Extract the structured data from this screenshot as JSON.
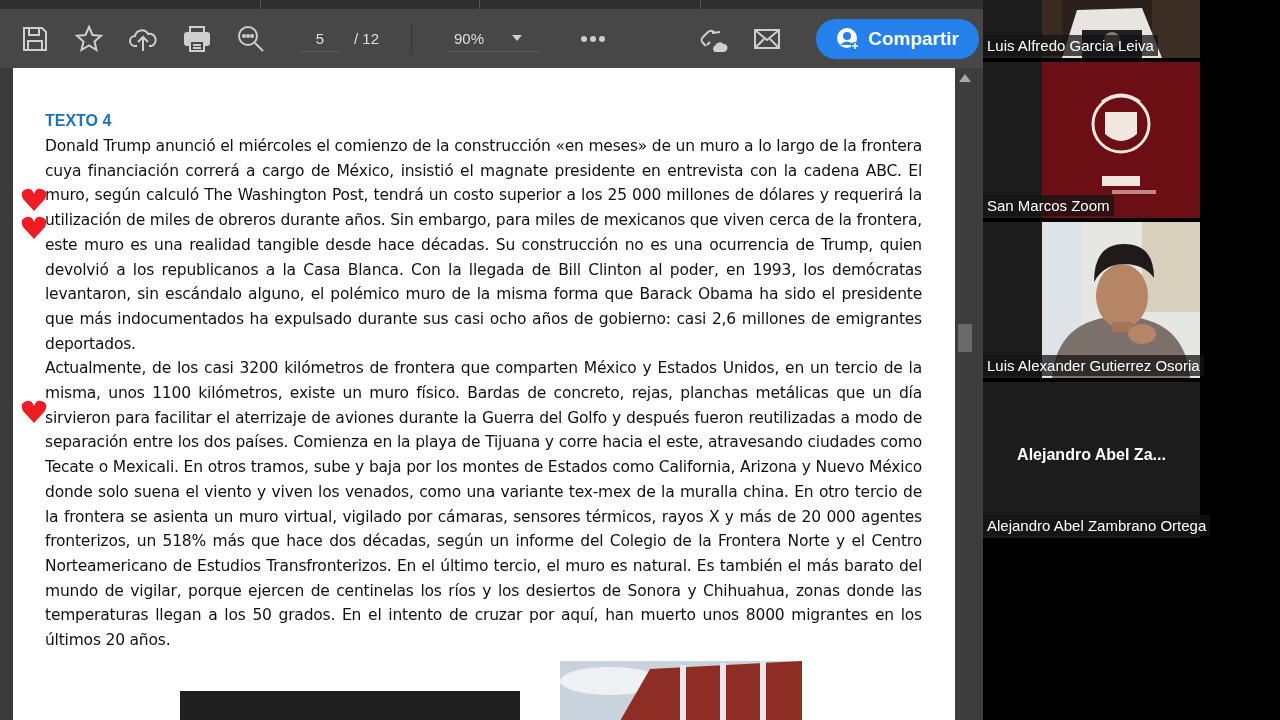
{
  "toolbar": {
    "page_current": "5",
    "page_total": "/ 12",
    "zoom": "90%",
    "share_button": "Compartir"
  },
  "document": {
    "heading": "TEXTO 4",
    "paragraphs": [
      "Donald Trump anunció el miércoles el comienzo de la construcción «en meses» de un muro a lo largo de la frontera cuya financiación correrá a cargo de México, insistió el magnate presidente en entrevista con la cadena ABC. El muro, según calculó The Washington Post, tendrá un costo superior a los 25 000 millones de dólares y requerirá la utilización de miles de obreros durante años. Sin embargo, para miles de mexicanos que viven cerca de la frontera, este muro es una realidad tangible desde hace décadas. Su construcción no es una ocurrencia de Trump, quien devolvió a los republicanos a la Casa Blanca. Con la llegada de Bill Clinton al poder, en 1993, los demócratas levantaron, sin escándalo alguno, el polémico muro de la misma forma que Barack Obama ha sido el presidente que más indocumentados ha expulsado durante sus casi ocho años de gobierno: casi 2,6 millones de emigrantes deportados.",
      "Actualmente, de los casi 3200 kilómetros de frontera que comparten México y Estados Unidos, en un tercio de la misma, unos 1100 kilómetros, existe un muro físico. Bardas de concreto, rejas, planchas metálicas que un día sirvieron para facilitar el aterrizaje de aviones durante la Guerra del Golfo y después fueron reutilizadas a modo de separación entre los dos países. Comienza en la playa de Tijuana y corre hacia el este, atravesando ciudades como Tecate o Mexicali. En otros tramos, sube y baja por los montes de Estados como California, Arizona y Nuevo México donde solo suena el viento y viven los venados, como una variante tex-mex de la muralla china. En otro tercio de la frontera se asienta un muro virtual, vigilado por cámaras, sensores térmicos, rayos X y más de 20 000 agentes fronterizos, un 518% más que hace dos décadas, según un informe del Colegio de la Frontera Norte y el Centro Norteamericano de Estudios Transfronterizos. En el último tercio, el muro es natural. Es también el más barato del mundo de vigilar, porque ejercen de centinelas los ríos y los desiertos de Sonora y Chihuahua, zonas donde las temperaturas llegan a los 50 grados. En el intento de cruzar por aquí, han muerto unos 8000 migrantes en los últimos 20 años."
    ]
  },
  "participants": [
    {
      "kind": "video",
      "name": "Luis Alfredo Garcia Leiva"
    },
    {
      "kind": "logo",
      "name": "San Marcos Zoom"
    },
    {
      "kind": "person",
      "name": "Luis Alexander Gutierrez Osoria"
    },
    {
      "kind": "avatar",
      "display_name": "Alejandro Abel Za...",
      "name": "Alejandro Abel Zambrano Ortega"
    }
  ]
}
